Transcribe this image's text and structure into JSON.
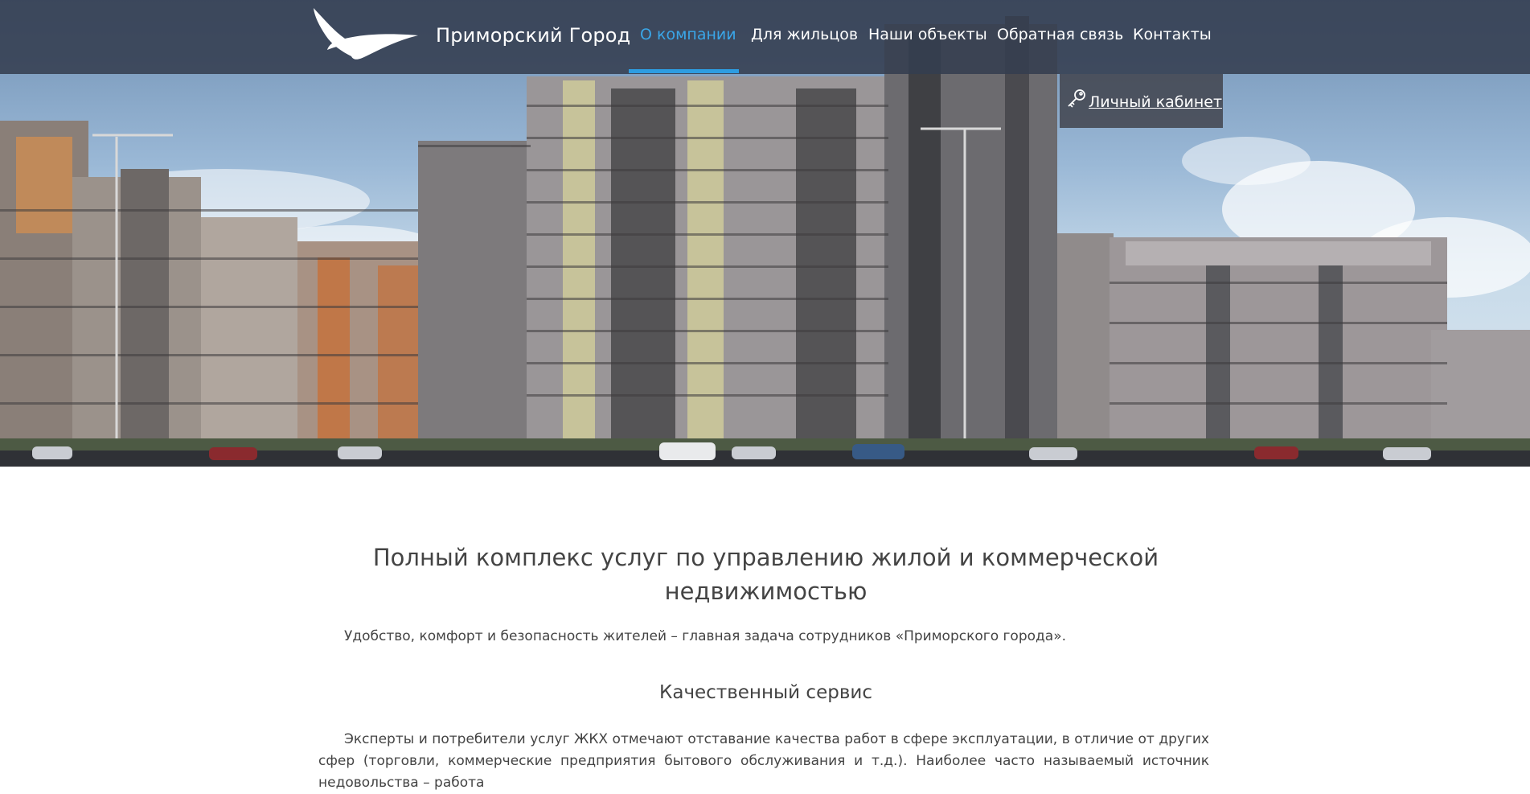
{
  "header": {
    "brand": "Приморский Город",
    "nav": [
      {
        "label": "О компании",
        "active": true
      },
      {
        "label": "Для жильцов",
        "active": false
      },
      {
        "label": "Наши объекты",
        "active": false
      },
      {
        "label": "Обратная связь",
        "active": false
      },
      {
        "label": "Контакты",
        "active": false
      }
    ],
    "cabinet_label": "Личный кабинет",
    "accent_color": "#2d9de2"
  },
  "main": {
    "title": "Полный комплекс услуг по управлению жилой и коммерческой недвижимостью",
    "intro": "Удобство, комфорт и безопасность жителей – главная задача сотрудников «Приморского города».",
    "subtitle": "Качественный сервис",
    "body": "Эксперты и потребители услуг ЖКХ отмечают отставание качества работ в сфере эксплуатации, в отличие от других сфер (торговли, коммерческие предприятия бытового обслуживания и т.д.). Наиболее часто называемый источник недовольства – работа"
  },
  "icons": {
    "logo": "seagull-logo-icon",
    "cabinet": "key-icon"
  }
}
